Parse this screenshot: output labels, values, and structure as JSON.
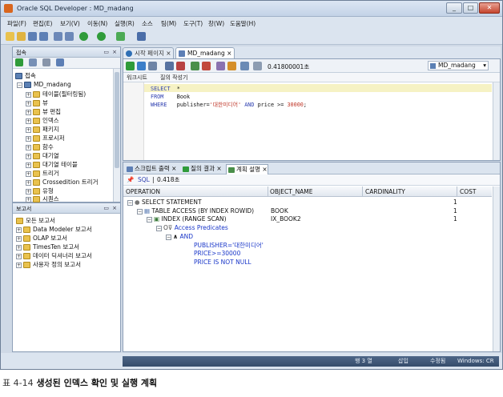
{
  "window": {
    "title": "Oracle SQL Developer : MD_madang"
  },
  "menu": [
    "파일(F)",
    "편집(E)",
    "보기(V)",
    "이동(N)",
    "실행(R)",
    "소스",
    "팀(M)",
    "도구(T)",
    "창(W)",
    "도움말(H)"
  ],
  "connections_panel": {
    "title": "접속",
    "root": "접속",
    "connection": "MD_madang",
    "items": [
      "테이블(필터링됨)",
      "뷰",
      "뷰 편집",
      "인덱스",
      "패키지",
      "프로시저",
      "함수",
      "대기열",
      "대기열 테이블",
      "트리거",
      "Crossedition 트리거",
      "유형",
      "시퀀스"
    ]
  },
  "reports_panel": {
    "title": "보고서",
    "items": [
      "모든 보고서",
      "Data Modeler 보고서",
      "OLAP 보고서",
      "TimesTen 보고서",
      "데이터 딕셔너리 보고서",
      "사용자 정의 보고서"
    ]
  },
  "doc_tabs": {
    "start": "시작 페이지",
    "active": "MD_madang"
  },
  "editor": {
    "elapsed": "0.41800001초",
    "connection_select": "MD_madang",
    "subtab_worksheet": "워크시트",
    "subtab_builder": "질의 작성기",
    "code": {
      "select": "SELECT",
      "star": "*",
      "from": "FROM",
      "table": "Book",
      "where": "WHERE",
      "cond_col": "publisher=",
      "cond_str": "'대한미디어'",
      "and": "AND",
      "cond_col2": "price >=",
      "cond_num": "30000",
      "semi": ";"
    }
  },
  "result_tabs": [
    "스크립트 출력",
    "질의 결과",
    "계획 설명"
  ],
  "result_info": {
    "sql_label": "SQL",
    "time": "0.418초"
  },
  "plan": {
    "columns": [
      "OPERATION",
      "OBJECT_NAME",
      "CARDINALITY",
      "COST"
    ],
    "rows": [
      {
        "op": "SELECT STATEMENT",
        "obj": "",
        "card": "",
        "cost": "1"
      },
      {
        "op": "TABLE ACCESS (BY INDEX ROWID)",
        "obj": "BOOK",
        "card": "",
        "cost": "1"
      },
      {
        "op": "INDEX (RANGE SCAN)",
        "obj": "IX_BOOK2",
        "card": "",
        "cost": "1"
      },
      {
        "op": "Access Predicates",
        "obj": "",
        "card": "",
        "cost": ""
      },
      {
        "op": "AND",
        "obj": "",
        "card": "",
        "cost": ""
      },
      {
        "op": "PUBLISHER='대한미디어'",
        "obj": "",
        "card": "",
        "cost": ""
      },
      {
        "op": "PRICE>=30000",
        "obj": "",
        "card": "",
        "cost": ""
      },
      {
        "op": "PRICE IS NOT NULL",
        "obj": "",
        "card": "",
        "cost": ""
      }
    ]
  },
  "status": {
    "line": "행 3 열",
    "insert": "삽입",
    "modified": "수정됨",
    "platform": "Windows: CR"
  },
  "caption": {
    "label": "표 4-14",
    "text": "생성된 인덱스 확인 및 실행 계획"
  }
}
